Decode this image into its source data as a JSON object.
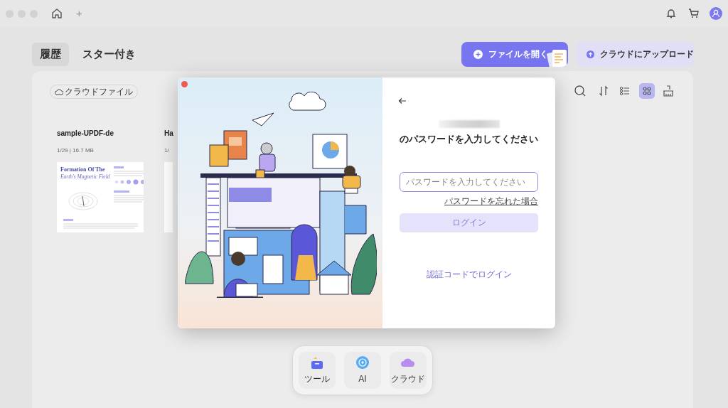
{
  "top_bar": {
    "new_tab": "+"
  },
  "tabs": [
    {
      "label": "履歴",
      "selected": true
    },
    {
      "label": "スター付き",
      "selected": false
    }
  ],
  "actions": [
    {
      "kind": "primary",
      "label": "ファイルを開く"
    },
    {
      "kind": "secondary",
      "label": "クラウドにアップロード"
    }
  ],
  "filter_chip": "クラウドファイル",
  "view_modes": [
    {
      "kind": "list",
      "selected": false
    },
    {
      "kind": "grid",
      "selected": true
    }
  ],
  "files": [
    {
      "name": "sample-UPDF-de",
      "meta": "1/29 | 16.7 MB",
      "thumbnail": {
        "title": "Formation Of The",
        "subtitle": "Earth's Magnetic Field"
      }
    },
    {
      "name": "Ha",
      "meta": "1/"
    }
  ],
  "dialog": {
    "heading": "のパスワードを入力してください",
    "password_field": {
      "placeholder": "パスワードを入力してください",
      "focused": true
    },
    "forgot_link": "パスワードを忘れた場合",
    "login_button": {
      "label": "ログイン",
      "disabled": true
    },
    "alt_login": "認証コードでログイン"
  },
  "dock": [
    {
      "kind": "tools",
      "label": "ツール"
    },
    {
      "kind": "ai",
      "label": "AI"
    },
    {
      "kind": "cloud",
      "label": "クラウド"
    }
  ]
}
